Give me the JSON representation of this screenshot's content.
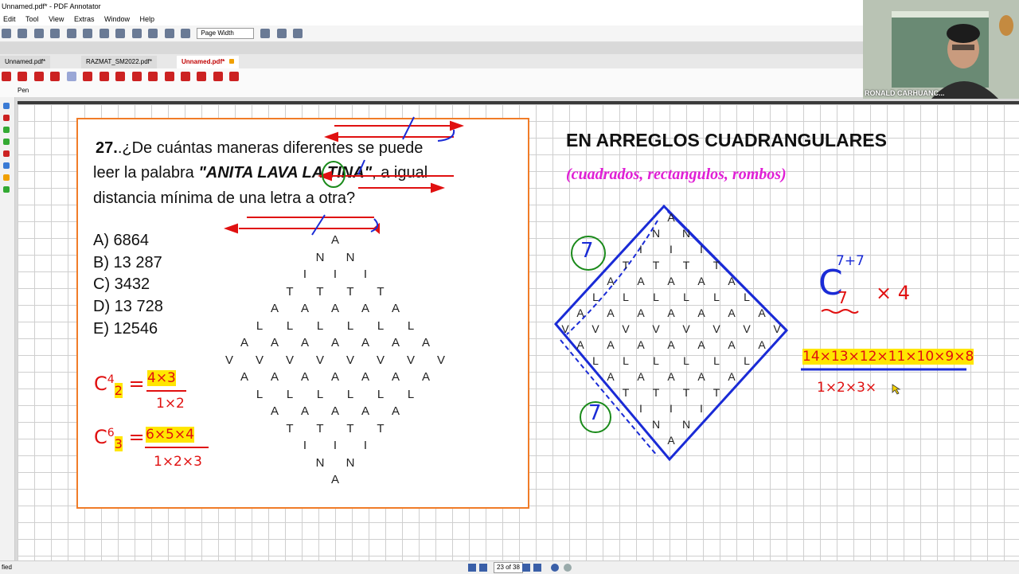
{
  "window": {
    "title": "Unnamed.pdf* - PDF Annotator"
  },
  "menu": [
    "Edit",
    "Tool",
    "View",
    "Extras",
    "Window",
    "Help"
  ],
  "toolbar": {
    "zoom": "Page Width"
  },
  "tabs": [
    "Unnamed.pdf*",
    "RAZMAT_SM2022.pdf*",
    "Unnamed.pdf*"
  ],
  "pen_label": "Pen",
  "video": {
    "name": "RONALD CARHUANC..."
  },
  "problem": {
    "number": "27.",
    "line1": ".¿De cuántas maneras diferentes se puede",
    "line2a": "leer la palabra ",
    "word": "\"ANITA LAVA LA TINA\"",
    "line2b": ", a igual",
    "line3": "distancia mínima de una letra a otra?",
    "options": [
      "A) 6864",
      "B) 13 287",
      "C) 3432",
      "D) 13 728",
      "E) 12546"
    ]
  },
  "diamond_rows": [
    [
      "A"
    ],
    [
      "N",
      "N"
    ],
    [
      "I",
      "I",
      "I"
    ],
    [
      "T",
      "T",
      "T",
      "T"
    ],
    [
      "A",
      "A",
      "A",
      "A",
      "A"
    ],
    [
      "L",
      "L",
      "L",
      "L",
      "L",
      "L"
    ],
    [
      "A",
      "A",
      "A",
      "A",
      "A",
      "A",
      "A"
    ],
    [
      "V",
      "V",
      "V",
      "V",
      "V",
      "V",
      "V",
      "V"
    ],
    [
      "A",
      "A",
      "A",
      "A",
      "A",
      "A",
      "A"
    ],
    [
      "L",
      "L",
      "L",
      "L",
      "L",
      "L"
    ],
    [
      "A",
      "A",
      "A",
      "A",
      "A"
    ],
    [
      "T",
      "T",
      "T",
      "T"
    ],
    [
      "I",
      "I",
      "I"
    ],
    [
      "N",
      "N"
    ],
    [
      "A"
    ]
  ],
  "rotated_rows": [
    [
      "A",
      "N",
      "I",
      "T",
      "A",
      "L",
      "A",
      "V"
    ],
    [
      "N",
      "I",
      "T",
      "A",
      "L",
      "A",
      "V",
      "A"
    ],
    [
      "I",
      "T",
      "A",
      "L",
      "A",
      "V",
      "A",
      "L"
    ],
    [
      "T",
      "A",
      "L",
      "A",
      "V",
      "A",
      "L",
      "A"
    ],
    [
      "A",
      "L",
      "A",
      "V",
      "A",
      "L",
      "A",
      "T"
    ],
    [
      "L",
      "A",
      "V",
      "A",
      "L",
      "A",
      "T",
      "I"
    ],
    [
      "A",
      "V",
      "A",
      "L",
      "A",
      "T",
      "I",
      "N"
    ],
    [
      "V",
      "A",
      "L",
      "A",
      "T",
      "I",
      "N",
      "A"
    ]
  ],
  "annotations": {
    "c1": "C",
    "c1_sup": "4",
    "c1_sub": "2",
    "c1_num": "4×3",
    "c1_den": "1×2",
    "c2": "C",
    "c2_sup": "6",
    "c2_sub": "3",
    "c2_num": "6×5×4",
    "c2_den": "1×2×3",
    "circle_top": "7",
    "circle_bottom": "7",
    "comb": "C",
    "comb_sup": "7+7",
    "comb_sub": "7",
    "comb_mult": "× 4",
    "big_num": "14×13×12×11×10×9×8",
    "big_den": "1×2×3×"
  },
  "right": {
    "heading": "EN ARREGLOS CUADRANGULARES",
    "sub": "(cuadrados, rectangulos, rombos)"
  },
  "status": {
    "left": "fied",
    "page": "23 of 38"
  },
  "colors": {
    "accent_orange": "#f07c28",
    "pen_red": "#e01010",
    "pen_blue": "#1a2bd6",
    "magenta": "#e01fd5"
  }
}
